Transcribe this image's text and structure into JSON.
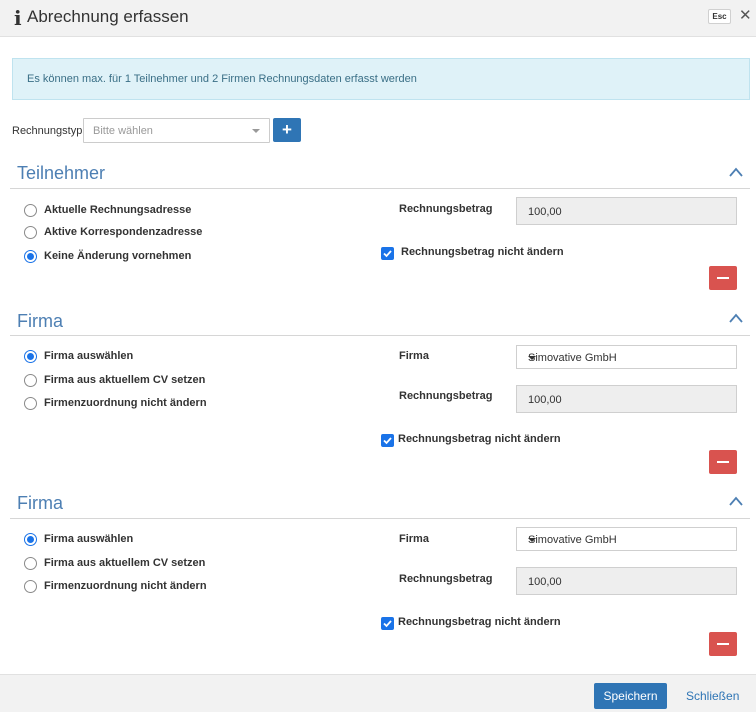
{
  "dialog": {
    "info_icon": "i",
    "title": "Abrechnung erfassen",
    "esc_label": "Esc",
    "close_glyph": "✕"
  },
  "info_banner": {
    "text": "Es können max. für 1 Teilnehmer und 2 Firmen Rechnungsdaten erfasst werden"
  },
  "rechnungstyp": {
    "label": "Rechnungstyp",
    "placeholder": "Bitte wählen",
    "add_label": "+"
  },
  "sections": [
    {
      "title": "Teilnehmer",
      "options": [
        {
          "label": "Aktuelle Rechnungsadresse",
          "checked": false
        },
        {
          "label": "Aktive Korrespondenzadresse",
          "checked": false
        },
        {
          "label": "Keine Änderung vornehmen",
          "checked": true
        }
      ],
      "amount_label": "Rechnungsbetrag",
      "amount_value": "100,00",
      "keep_amount_label": "Rechnungsbetrag nicht ändern",
      "keep_amount_checked": true
    },
    {
      "title": "Firma",
      "options": [
        {
          "label": "Firma auswählen",
          "checked": true
        },
        {
          "label": "Firma aus aktuellem CV setzen",
          "checked": false
        },
        {
          "label": "Firmenzuordnung nicht ändern",
          "checked": false
        }
      ],
      "firm_label": "Firma",
      "firm_value": "Simovative GmbH",
      "amount_label": "Rechnungsbetrag",
      "amount_value": "100,00",
      "keep_amount_label": "Rechnungsbetrag nicht ändern",
      "keep_amount_checked": true
    },
    {
      "title": "Firma",
      "options": [
        {
          "label": "Firma auswählen",
          "checked": true
        },
        {
          "label": "Firma aus aktuellem CV setzen",
          "checked": false
        },
        {
          "label": "Firmenzuordnung nicht ändern",
          "checked": false
        }
      ],
      "firm_label": "Firma",
      "firm_value": "Simovative GmbH",
      "amount_label": "Rechnungsbetrag",
      "amount_value": "100,00",
      "keep_amount_label": "Rechnungsbetrag nicht ändern",
      "keep_amount_checked": true
    }
  ],
  "footer": {
    "save_label": "Speichern",
    "close_label": "Schließen"
  },
  "colors": {
    "primary": "#2f75b5",
    "danger": "#d9534f",
    "section_title": "#4d7fb3",
    "banner_bg": "#dff2f8"
  }
}
